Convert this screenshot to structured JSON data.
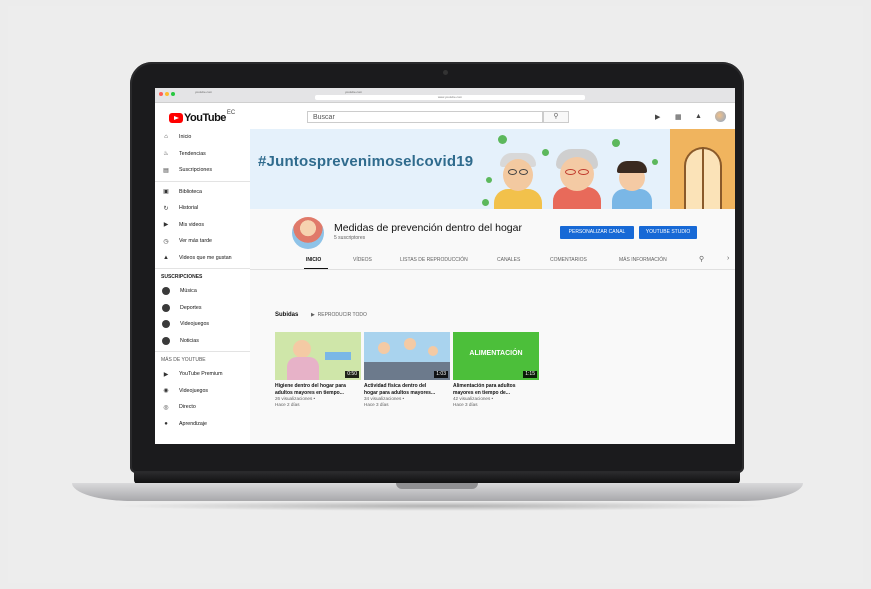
{
  "browser": {
    "tab_labels": [
      "youtube.com",
      "youtube.com"
    ],
    "url": "www.youtube.com"
  },
  "header": {
    "logo_text": "YouTube",
    "logo_region": "EC",
    "search_placeholder": "Buscar",
    "icons": [
      "video-camera-icon",
      "apps-icon",
      "bell-icon",
      "search-icon"
    ]
  },
  "sidebar": {
    "main_items": [
      {
        "label": "Inicio",
        "icon": "home-icon"
      },
      {
        "label": "Tendencias",
        "icon": "flame-icon"
      },
      {
        "label": "Suscripciones",
        "icon": "subscriptions-icon"
      }
    ],
    "library_items": [
      {
        "label": "Biblioteca",
        "icon": "library-icon"
      },
      {
        "label": "Historial",
        "icon": "history-icon"
      },
      {
        "label": "Mis videos",
        "icon": "my-videos-icon"
      },
      {
        "label": "Ver más tarde",
        "icon": "clock-icon"
      },
      {
        "label": "Videos que me gustan",
        "icon": "thumbs-up-icon"
      }
    ],
    "subscriptions_heading": "SUSCRIPCIONES",
    "subscriptions": [
      {
        "label": "Música"
      },
      {
        "label": "Deportes"
      },
      {
        "label": "Videojuegos"
      },
      {
        "label": "Noticias"
      }
    ],
    "more_heading": "MÁS DE YOUTUBE",
    "more_items": [
      {
        "label": "YouTube Premium",
        "icon": "youtube-icon"
      },
      {
        "label": "Videojuegos",
        "icon": "gamepad-icon"
      },
      {
        "label": "Directo",
        "icon": "live-icon"
      },
      {
        "label": "Aprendizaje",
        "icon": "bulb-icon"
      }
    ]
  },
  "banner": {
    "hashtag": "#Juntosprevenimoselcovid19"
  },
  "channel": {
    "name": "Medidas de prevención dentro del hogar",
    "subscribers": "5 suscriptores",
    "customize_button": "PERSONALIZAR CANAL",
    "studio_button": "YOUTUBE STUDIO"
  },
  "tabs": [
    "INICIO",
    "VÍDEOS",
    "LISTAS DE REPRODUCCIÓN",
    "CANALES",
    "COMENTARIOS",
    "MÁS INFORMACIÓN"
  ],
  "uploads": {
    "heading": "Subidas",
    "play_all": "REPRODUCIR TODO",
    "videos": [
      {
        "title_1": "Higiene dentro del hogar para",
        "title_2": "adultos mayores en tiempo...",
        "views": "26 visualizaciones •",
        "age": "Hace 2 días",
        "duration": "0:50",
        "thumb_color": "#cfe6a9"
      },
      {
        "title_1": "Actividad física dentro del",
        "title_2": "hogar para adultos mayores...",
        "views": "34 visualizaciones •",
        "age": "Hace 3 días",
        "duration": "1:03",
        "thumb_color": "#a9d3ee"
      },
      {
        "title_1": "Alimentación para adultos",
        "title_2": "mayores en tiempo de...",
        "views": "42 visualizaciones •",
        "age": "Hace 3 días",
        "duration": "1:15",
        "thumb_color": "#4cbf3a",
        "thumb_text": "ALIMENTACIÓN"
      }
    ]
  }
}
